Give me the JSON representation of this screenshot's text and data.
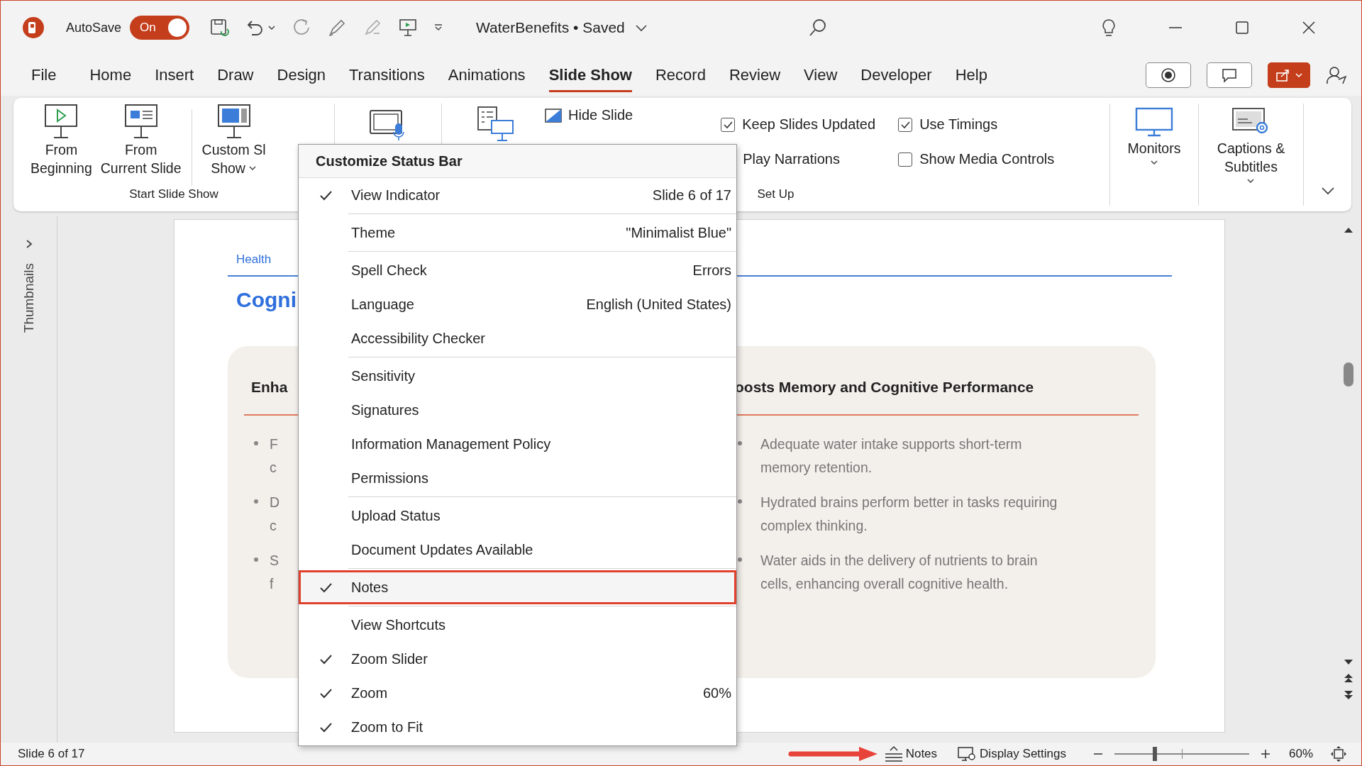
{
  "title_bar": {
    "autosave_label": "AutoSave",
    "autosave_toggle": {
      "label": "On",
      "on": true
    },
    "document_title": "WaterBenefits • Saved"
  },
  "tabs": [
    {
      "label": "File",
      "selected": false
    },
    {
      "label": "Home",
      "selected": false
    },
    {
      "label": "Insert",
      "selected": false
    },
    {
      "label": "Draw",
      "selected": false
    },
    {
      "label": "Design",
      "selected": false
    },
    {
      "label": "Transitions",
      "selected": false
    },
    {
      "label": "Animations",
      "selected": false
    },
    {
      "label": "Slide Show",
      "selected": true
    },
    {
      "label": "Record",
      "selected": false
    },
    {
      "label": "Review",
      "selected": false
    },
    {
      "label": "View",
      "selected": false
    },
    {
      "label": "Developer",
      "selected": false
    },
    {
      "label": "Help",
      "selected": false
    }
  ],
  "ribbon": {
    "start_slide_show": {
      "label": "Start Slide Show",
      "buttons": [
        {
          "kind": "from-beginning",
          "lines": [
            "From",
            "Beginning"
          ],
          "dropdown": false
        },
        {
          "kind": "from-current",
          "lines": [
            "From",
            "Current Slide"
          ],
          "dropdown": false
        },
        {
          "kind": "custom-show",
          "lines": [
            "Custom Sl",
            "Show"
          ],
          "dropdown": true
        }
      ]
    },
    "set_up": {
      "label": "Set Up",
      "hide_slide": "Hide Slide",
      "options": [
        {
          "kind": "checkbox",
          "label": "Keep Slides Updated",
          "checked": true
        },
        {
          "kind": "checkbox",
          "label": "Use Timings",
          "checked": true
        },
        {
          "kind": "covered",
          "label": "Play Narrations"
        },
        {
          "kind": "checkbox",
          "label": "Show Media Controls",
          "checked": false
        }
      ]
    },
    "monitors": {
      "lines": [
        "Monitors"
      ],
      "dropdown": true
    },
    "captions": {
      "lines": [
        "Captions &",
        "Subtitles"
      ],
      "dropdown": true
    }
  },
  "sidebar": {
    "label": "Thumbnails"
  },
  "slide": {
    "tag": "Health",
    "title": "Cogni",
    "card": {
      "left_heading": "Enha",
      "right_heading": "oosts Memory and Cognitive Performance",
      "left_bullets": [
        {
          "lines": [
            "F",
            "c"
          ]
        },
        {
          "lines": [
            "D",
            "c"
          ]
        },
        {
          "lines": [
            "S",
            "f"
          ]
        }
      ],
      "right_bullets": [
        {
          "lines": [
            "Adequate water intake supports short-term",
            "memory retention."
          ]
        },
        {
          "lines": [
            "Hydrated brains perform better in tasks requiring",
            "complex thinking."
          ]
        },
        {
          "lines": [
            "Water aids in the delivery of nutrients to brain",
            "cells, enhancing overall cognitive health."
          ]
        }
      ]
    }
  },
  "context_menu": {
    "title": "Customize Status Bar",
    "groups": [
      [
        {
          "label": "View Indicator",
          "value": "Slide 6 of 17",
          "checked": true,
          "highlighted": false
        }
      ],
      [
        {
          "label": "Theme",
          "value": "\"Minimalist Blue\"",
          "checked": false,
          "highlighted": false
        }
      ],
      [
        {
          "label": "Spell Check",
          "value": "Errors",
          "checked": false,
          "highlighted": false
        },
        {
          "label": "Language",
          "value": "English (United States)",
          "checked": false,
          "highlighted": false
        },
        {
          "label": "Accessibility Checker",
          "checked": false,
          "highlighted": false
        }
      ],
      [
        {
          "label": "Sensitivity",
          "checked": false,
          "highlighted": false
        },
        {
          "label": "Signatures",
          "checked": false,
          "highlighted": false
        },
        {
          "label": "Information Management Policy",
          "checked": false,
          "highlighted": false
        },
        {
          "label": "Permissions",
          "checked": false,
          "highlighted": false
        }
      ],
      [
        {
          "label": "Upload Status",
          "checked": false,
          "highlighted": false
        },
        {
          "label": "Document Updates Available",
          "checked": false,
          "highlighted": false
        }
      ],
      [
        {
          "label": "Notes",
          "checked": true,
          "highlighted": true
        }
      ],
      [
        {
          "label": "View Shortcuts",
          "checked": false,
          "highlighted": false
        },
        {
          "label": "Zoom Slider",
          "checked": true,
          "highlighted": false
        },
        {
          "label": "Zoom",
          "value": "60%",
          "checked": true,
          "highlighted": false
        },
        {
          "label": "Zoom to Fit",
          "checked": true,
          "highlighted": false
        }
      ]
    ]
  },
  "status_bar": {
    "slide_indicator": "Slide 6 of 17",
    "notes": "Notes",
    "display_settings": "Display Settings",
    "zoom_slider": {
      "level": 0.3
    },
    "zoom": "60%"
  }
}
